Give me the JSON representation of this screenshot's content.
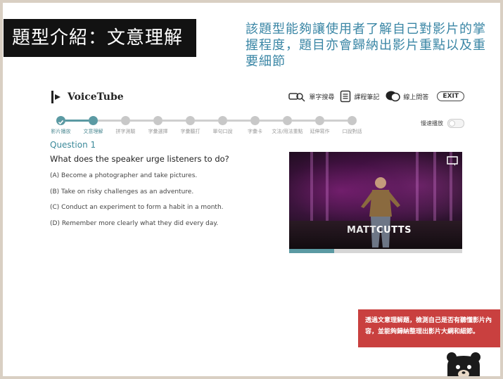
{
  "slide": {
    "title": "題型介紹：文意理解",
    "description": "該題型能夠讓使用者了解自己對影片的掌握程度，題目亦會歸納出影片重點以及重要細節"
  },
  "app": {
    "brand": "VoiceTube",
    "tools": {
      "word_lookup": "單字搜尋",
      "course_notes": "課程筆記",
      "online_qa": "線上問答",
      "exit": "EXIT"
    },
    "steps": [
      "影片播放",
      "文意理解",
      "拼字測驗",
      "字彙選擇",
      "字彙聽打",
      "單句口說",
      "字彙卡",
      "文法/用法重點",
      "延伸寫作",
      "口說對話"
    ],
    "current_step_index": 1,
    "autoplay_label": "慢速播放",
    "autoplay_on": false,
    "question": {
      "title": "Question 1",
      "text": "What does the speaker urge listeners to do?",
      "options": [
        "(A) Become a photographer and take pictures.",
        "(B) Take on risky challenges as an adventure.",
        "(C) Conduct an experiment to form a habit in a month.",
        "(D) Remember more clearly what they did every day."
      ]
    },
    "video": {
      "watermark_first": "MATT",
      "watermark_last": "CUTTS",
      "progress_fraction": 0.26
    }
  },
  "tip": {
    "text": "透過文意理解題，檢測自己是否有聽懂影片內容，並能夠歸納整理出影片大綱和細節。"
  },
  "colors": {
    "accent": "#5b9aa3",
    "title_bg": "#121212",
    "desc_text": "#3a86a5",
    "tip_bg": "#c9403f",
    "frame": "#d9cfc3"
  }
}
